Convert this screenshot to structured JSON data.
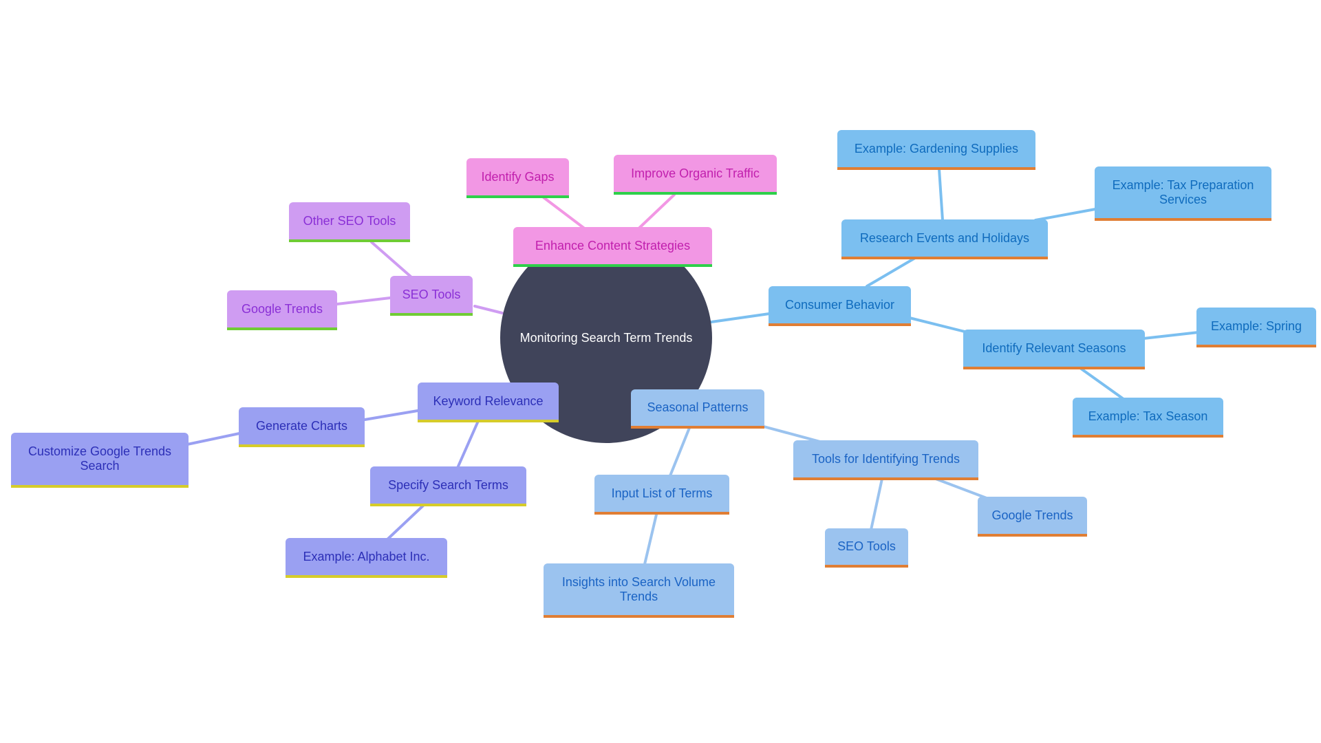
{
  "root": {
    "label": "Monitoring Search Term Trends",
    "color": "#40445a"
  },
  "branches": {
    "content": {
      "label": "Enhance Content Strategies",
      "children": [
        "Identify Gaps",
        "Improve Organic Traffic"
      ],
      "color": "#f297e4"
    },
    "seo": {
      "label": "SEO Tools",
      "children": [
        "Other SEO Tools",
        "Google Trends"
      ],
      "color": "#cf9cf2"
    },
    "keyword": {
      "label": "Keyword Relevance",
      "generate_charts": "Generate Charts",
      "customize": "Customize Google Trends Search",
      "specify": "Specify Search Terms",
      "example_alphabet": "Example: Alphabet Inc.",
      "color": "#9aa0f2"
    },
    "consumer": {
      "label": "Consumer Behavior",
      "research": "Research Events and Holidays",
      "gardening": "Example: Gardening Supplies",
      "tax_prep": "Example: Tax Preparation Services",
      "seasons": "Identify Relevant Seasons",
      "spring": "Example: Spring",
      "tax_season": "Example: Tax Season",
      "color": "#7bbff0"
    },
    "seasonal": {
      "label": "Seasonal Patterns",
      "input_list": "Input List of Terms",
      "insights": "Insights into Search Volume Trends",
      "tools": "Tools for Identifying Trends",
      "google_trends": "Google Trends",
      "seo_tools": "SEO Tools",
      "color": "#9bc3ef"
    }
  }
}
